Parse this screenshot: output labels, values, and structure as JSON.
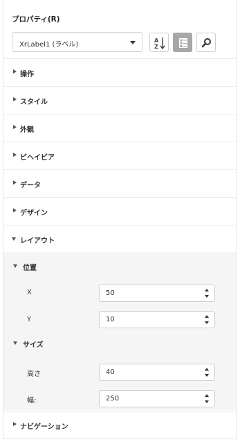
{
  "panel": {
    "title": "プロパティ(R)",
    "selector_value": "XrLabel1 (ラベル)"
  },
  "toolbar": {
    "sort_icon": "sort-az-icon",
    "categorize_icon": "categorize-icon",
    "search_icon": "search-icon",
    "categorize_active_color": "#a7a7a7"
  },
  "sections": [
    {
      "label": "操作"
    },
    {
      "label": "スタイル"
    },
    {
      "label": "外観"
    },
    {
      "label": "ビヘイビア"
    },
    {
      "label": "データ"
    },
    {
      "label": "デザイン"
    },
    {
      "label": "レイアウト"
    },
    {
      "label": "ナビゲーション"
    }
  ],
  "layout": {
    "position": {
      "label": "位置",
      "x_label": "X",
      "x_value": "50",
      "y_label": "Y",
      "y_value": "10"
    },
    "size": {
      "label": "サイズ",
      "height_label": "高さ",
      "height_value": "40",
      "width_label": "幅:",
      "width_value": "250"
    }
  }
}
